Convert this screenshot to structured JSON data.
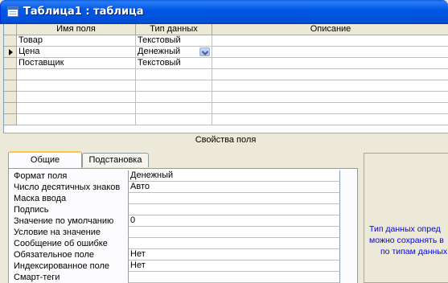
{
  "window": {
    "title": "Таблица1 : таблица"
  },
  "grid": {
    "headers": {
      "name": "Имя поля",
      "type": "Тип данных",
      "description": "Описание"
    },
    "rows": [
      {
        "name": "Товар",
        "type": "Текстовый",
        "description": ""
      },
      {
        "name": "Цена",
        "type": "Денежный",
        "description": ""
      },
      {
        "name": "Поставщик",
        "type": "Текстовый",
        "description": ""
      }
    ],
    "current_row_index": 1,
    "empty_rows": 7
  },
  "properties": {
    "label": "Свойства поля",
    "tabs": [
      "Общие",
      "Подстановка"
    ],
    "active_tab": "Общие",
    "fields": [
      {
        "label": "Формат поля",
        "value": "Денежный"
      },
      {
        "label": "Число десятичных знаков",
        "value": "Авто"
      },
      {
        "label": "Маска ввода",
        "value": ""
      },
      {
        "label": "Подпись",
        "value": ""
      },
      {
        "label": "Значение по умолчанию",
        "value": "0"
      },
      {
        "label": "Условие на значение",
        "value": ""
      },
      {
        "label": "Сообщение об ошибке",
        "value": ""
      },
      {
        "label": "Обязательное поле",
        "value": "Нет"
      },
      {
        "label": "Индексированное поле",
        "value": "Нет"
      },
      {
        "label": "Смарт-теги",
        "value": ""
      }
    ]
  },
  "help": {
    "lines": [
      "Тип данных опред",
      "можно сохранять в",
      "по типам данных"
    ]
  },
  "colors": {
    "titlebar": "#0058e6",
    "help_text": "#0000ff",
    "active_tab_accent": "#ffc83c"
  }
}
